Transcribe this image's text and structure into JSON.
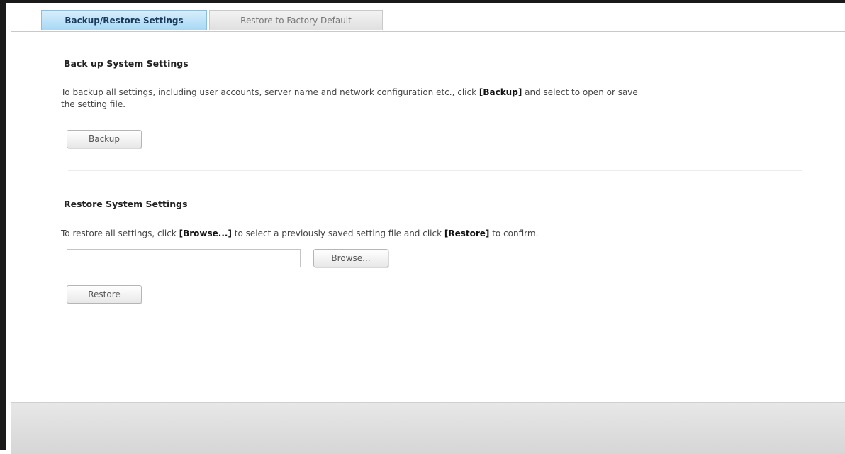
{
  "tabs": {
    "active_label": "Backup/Restore Settings",
    "inactive_label": "Restore to Factory Default"
  },
  "backup": {
    "title": "Back up System Settings",
    "desc_line1_pre": "To backup all settings, including user accounts, server name and network configuration etc., click ",
    "desc_line1_bold": "[Backup]",
    "desc_line1_post": " and select to open or save",
    "desc_line2": "the setting file.",
    "button_label": "Backup"
  },
  "restore": {
    "title": "Restore System Settings",
    "desc_pre": "To restore all settings, click ",
    "desc_bold1": "[Browse...]",
    "desc_mid": " to select a previously saved setting file and click ",
    "desc_bold2": "[Restore]",
    "desc_post": " to confirm.",
    "file_value": "",
    "browse_label": "Browse...",
    "button_label": "Restore"
  }
}
